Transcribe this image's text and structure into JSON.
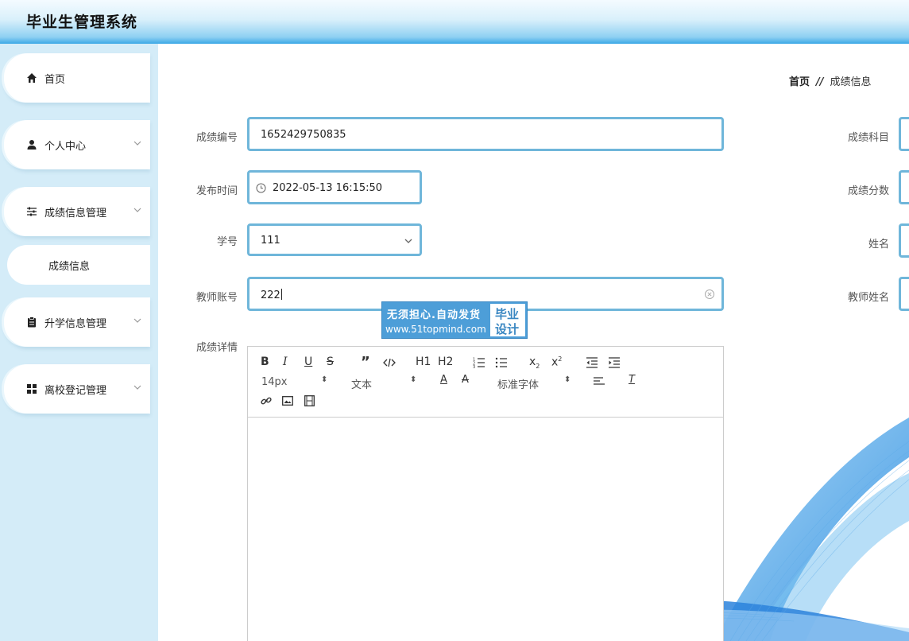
{
  "app": {
    "title": "毕业生管理系统"
  },
  "sidebar": {
    "items": [
      {
        "label": "首页"
      },
      {
        "label": "个人中心"
      },
      {
        "label": "成绩信息管理"
      },
      {
        "label": "升学信息管理"
      },
      {
        "label": "离校登记管理"
      }
    ],
    "sub_items": [
      {
        "label": "成绩信息"
      }
    ]
  },
  "breadcrumb": {
    "home": "首页",
    "separator": "//",
    "current": "成绩信息"
  },
  "form": {
    "score_id": {
      "label": "成绩编号",
      "value": "1652429750835"
    },
    "publish_time": {
      "label": "发布时间",
      "value": "2022-05-13 16:15:50"
    },
    "student_no": {
      "label": "学号",
      "value": "111"
    },
    "teacher_account": {
      "label": "教师账号",
      "value": "222"
    },
    "details": {
      "label": "成绩详情"
    },
    "subject": {
      "label": "成绩科目"
    },
    "score": {
      "label": "成绩分数"
    },
    "name": {
      "label": "姓名"
    },
    "teacher_name": {
      "label": "教师姓名"
    }
  },
  "editor": {
    "font_size": "14px",
    "text_type": "文本",
    "font_family": "标准字体",
    "h1": "H1",
    "h2": "H2"
  },
  "watermark": {
    "line1": "无须担心.自动发货",
    "line2": "www.51topmind.com",
    "box_line1": "毕业",
    "box_line2": "设计"
  },
  "colors": {
    "accent": "#6fb6da",
    "sidebar_bg": "#d4ecf8",
    "header_blue": "#3aa8e6"
  }
}
